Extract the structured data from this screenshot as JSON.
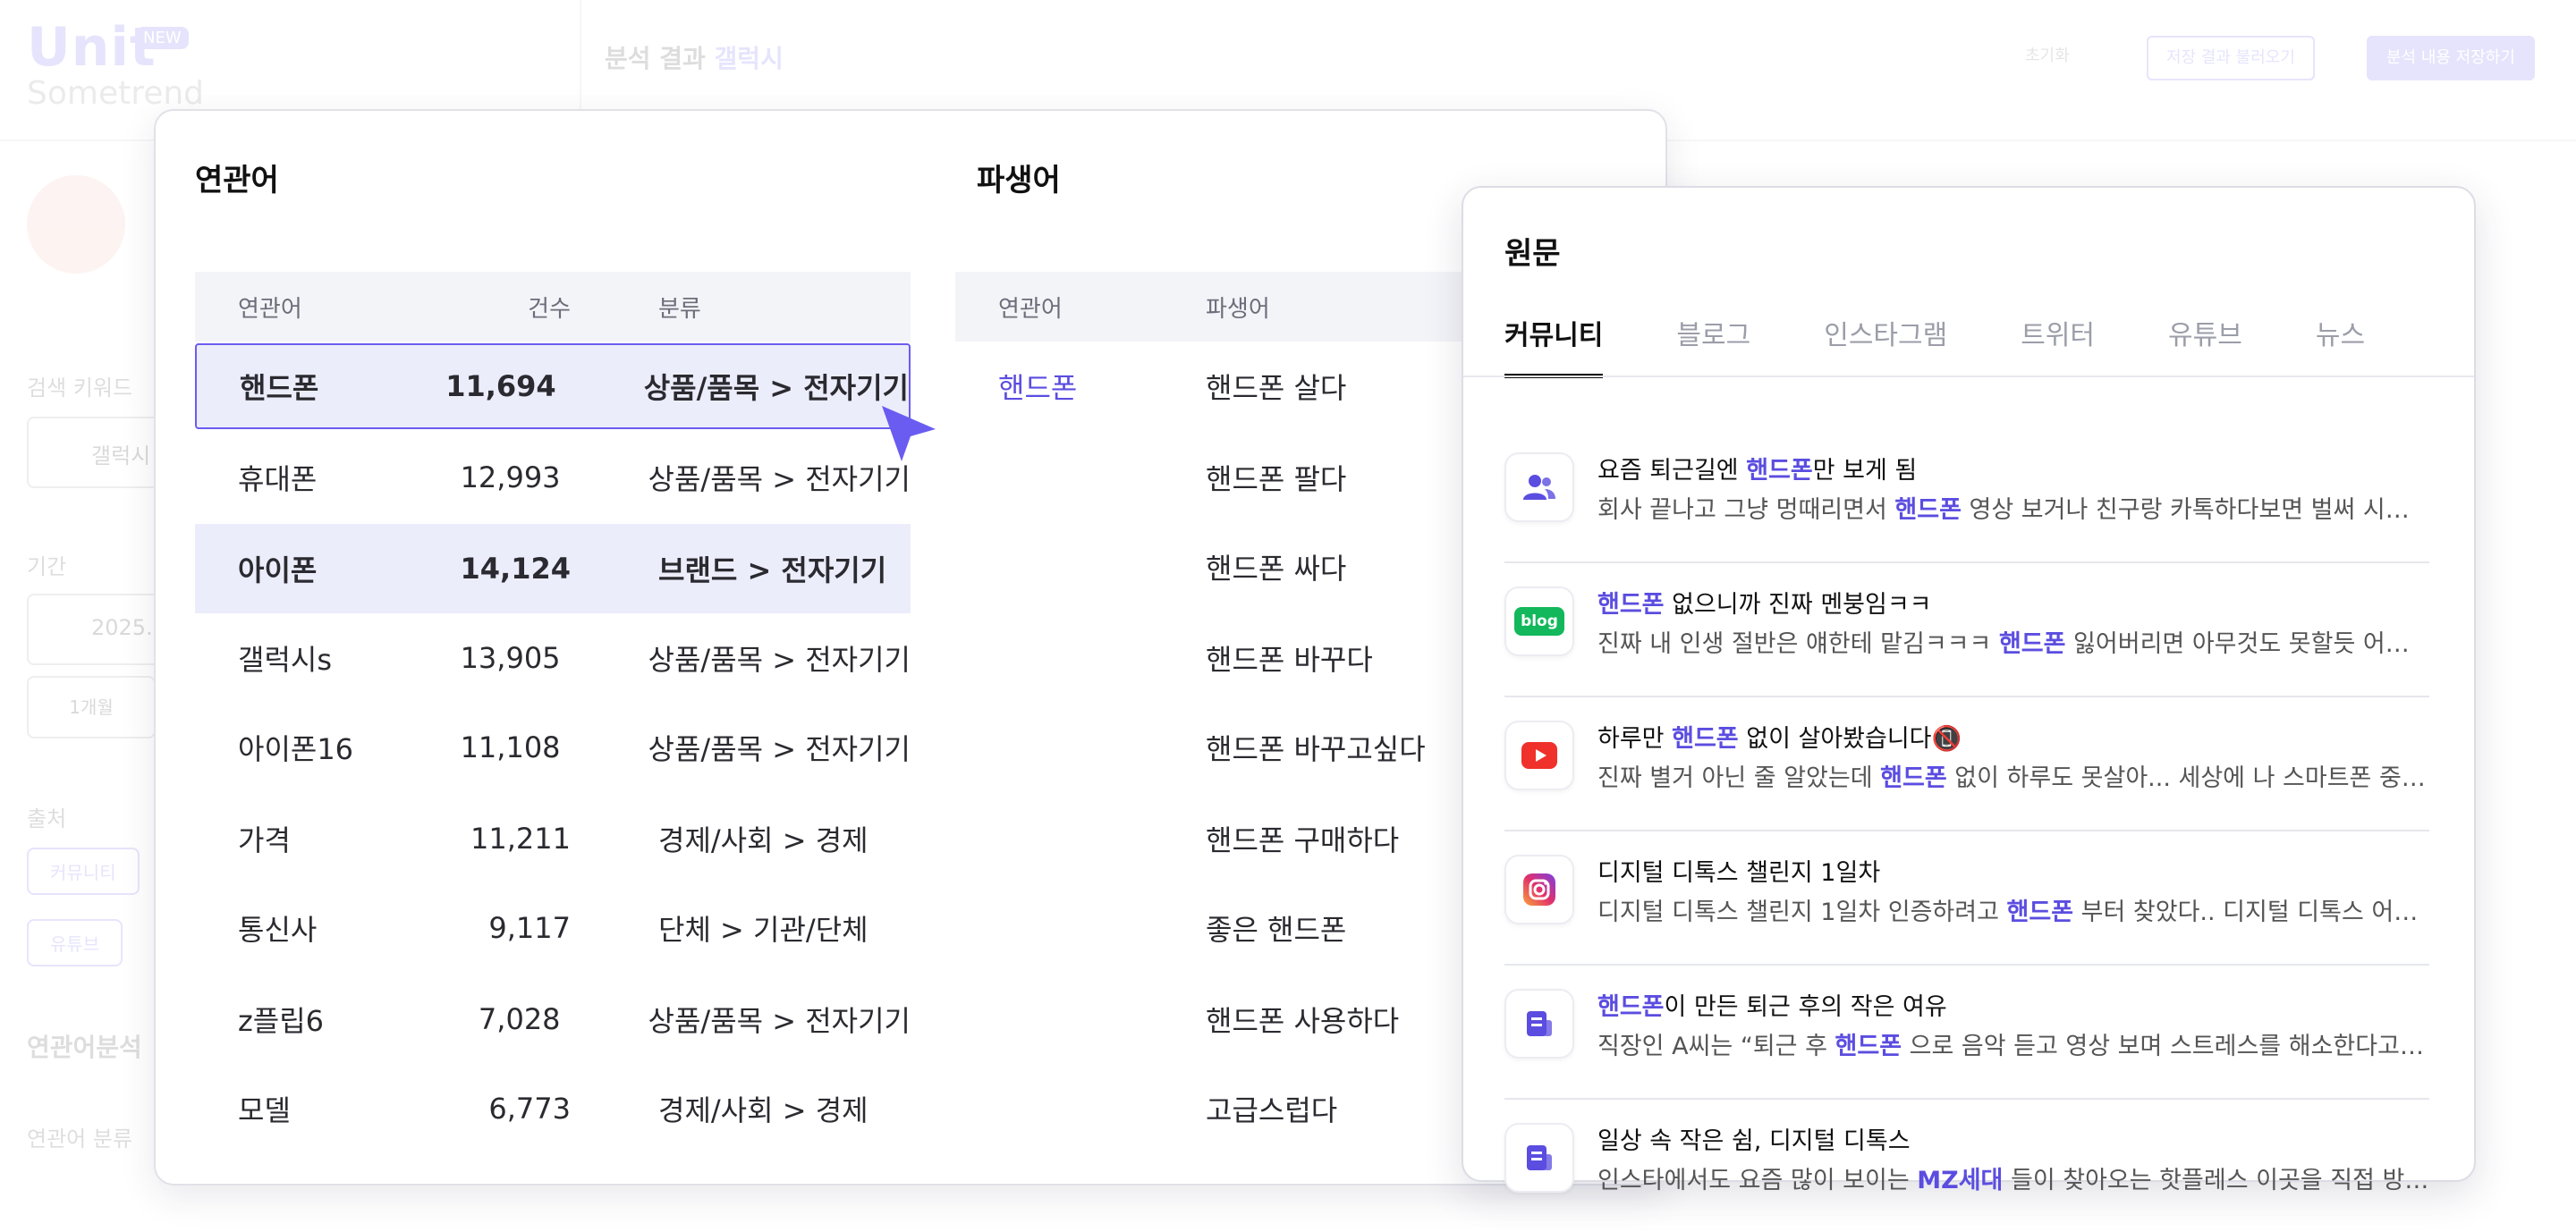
{
  "background": {
    "logo": {
      "name": "Unit",
      "badge": "NEW",
      "brand": "Sometrend"
    },
    "header": {
      "prefix": "분석 결과",
      "keyword": "갤럭시"
    },
    "top_buttons": {
      "reset": "초기화",
      "load": "저장 결과 불러오기",
      "save": "분석 내용 저장하기"
    },
    "sidebar": {
      "keyword_label": "검색 키워드",
      "keyword_value": "갤럭시",
      "period_label": "기간",
      "period_value": "2025.",
      "period_chip": "1개월",
      "source_label": "출처",
      "source_chips": [
        "커뮤니티",
        "유튜브"
      ],
      "section_label": "연관어분석",
      "sub_label": "연관어 분류"
    }
  },
  "related": {
    "title": "연관어",
    "headers": {
      "term": "연관어",
      "count": "건수",
      "category": "분류"
    },
    "rows": [
      {
        "term": "핸드폰",
        "count": "11,694",
        "category": "상품/품목 > 전자기기"
      },
      {
        "term": "휴대폰",
        "count": "12,993",
        "category": "상품/품목 > 전자기기"
      },
      {
        "term": "아이폰",
        "count": "14,124",
        "category": "브랜드 > 전자기기"
      },
      {
        "term": "갤럭시s",
        "count": "13,905",
        "category": "상품/품목 > 전자기기"
      },
      {
        "term": "아이폰16",
        "count": "11,108",
        "category": "상품/품목 > 전자기기"
      },
      {
        "term": "가격",
        "count": "11,211",
        "category": "경제/사회 > 경제"
      },
      {
        "term": "통신사",
        "count": "9,117",
        "category": "단체 > 기관/단체"
      },
      {
        "term": "z플립6",
        "count": "7,028",
        "category": "상품/품목 > 전자기기"
      },
      {
        "term": "모델",
        "count": "6,773",
        "category": "경제/사회 > 경제"
      }
    ]
  },
  "derived": {
    "title": "파생어",
    "headers": {
      "term": "연관어",
      "word": "파생어"
    },
    "term": "핸드폰",
    "words": [
      "핸드폰 살다",
      "핸드폰 팔다",
      "핸드폰 싸다",
      "핸드폰 바꾸다",
      "핸드폰 바꾸고싶다",
      "핸드폰 구매하다",
      "좋은 핸드폰",
      "핸드폰 사용하다",
      "고급스럽다"
    ]
  },
  "source": {
    "title": "원문",
    "tabs": [
      "커뮤니티",
      "블로그",
      "인스타그램",
      "트위터",
      "유튜브",
      "뉴스"
    ],
    "items": [
      {
        "icon": "community-icon",
        "title_pre": "요즘 퇴근길엔 ",
        "title_kw": "핸드폰",
        "title_post": "만 보게 됨",
        "body_pre": "회사 끝나고 그냥 멍때리면서 ",
        "body_kw": "핸드폰",
        "body_post": " 영상 보거나 친구랑 카톡하다보면 벌써 시간이..."
      },
      {
        "icon": "blog-icon",
        "icon_text": "blog",
        "title_pre": "",
        "title_kw": "핸드폰",
        "title_post": " 없으니까 진짜 멘붕임ㅋㅋ",
        "body_pre": "진짜 내 인생 절반은 얘한테 맡김ㅋㅋㅋ ",
        "body_kw": "핸드폰",
        "body_post": " 잃어버리면 아무것도 못할듯 어떡하냐..."
      },
      {
        "icon": "youtube-icon",
        "title_pre": "하루만 ",
        "title_kw": "핸드폰",
        "title_post": " 없이 살아봤습니다📵",
        "body_pre": "진짜 별거 아닌 줄 알았는데 ",
        "body_kw": "핸드폰",
        "body_post": " 없이 하루도 못살아... 세상에 나 스마트폰 중독인가..."
      },
      {
        "icon": "instagram-icon",
        "title_pre": "디지털 디톡스 챌린지 1일차",
        "title_kw": "",
        "title_post": "",
        "body_pre": "디지털 디톡스 챌린지 1일차 인증하려고 ",
        "body_kw": "핸드폰",
        "body_post": " 부터 찾았다.. 디지털 디톡스 어떻게 하..."
      },
      {
        "icon": "news-icon",
        "title_pre": "",
        "title_kw": "핸드폰",
        "title_post": "이 만든 퇴근 후의 작은 여유",
        "body_pre": "직장인 A씨는 “퇴근 후 ",
        "body_kw": "핸드폰",
        "body_post": " 으로 음악 듣고 영상 보며 스트레스를 해소한다고 합니..."
      },
      {
        "icon": "news-icon",
        "title_pre": "일상 속 작은 쉼, 디지털 디톡스",
        "title_kw": "",
        "title_post": "",
        "body_pre": "인스타에서도 요즘 많이 보이는 ",
        "body_kw": "MZ세대",
        "body_post": " 들이 찾아오는 핫플레스 이곳을 직접 방문해..."
      }
    ]
  },
  "colors": {
    "accent": "#5b4de0",
    "highlight": "#ecedfb",
    "youtube": "#f0302a",
    "blog": "#12b85b"
  }
}
